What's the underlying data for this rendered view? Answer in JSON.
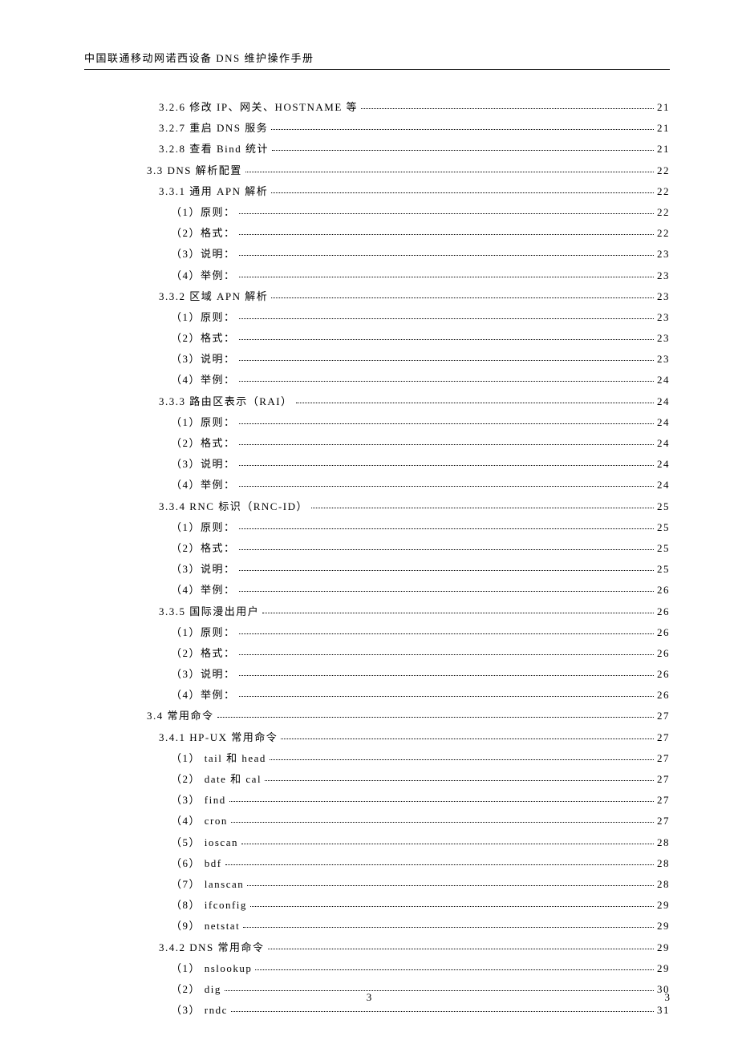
{
  "header": "中国联通移动网诺西设备 DNS 维护操作手册",
  "toc": [
    {
      "level": "level-3",
      "label": "3.2.6 修改 IP、网关、HOSTNAME 等",
      "page": "21"
    },
    {
      "level": "level-3",
      "label": "3.2.7 重启 DNS 服务",
      "page": "21"
    },
    {
      "level": "level-3",
      "label": "3.2.8 查看 Bind 统计",
      "page": "21"
    },
    {
      "level": "level-2",
      "label": "3.3 DNS 解析配置",
      "page": "22"
    },
    {
      "level": "level-3",
      "label": "3.3.1 通用 APN 解析",
      "page": "22"
    },
    {
      "level": "level-4",
      "label": "（1）原则：",
      "page": "22"
    },
    {
      "level": "level-4",
      "label": "（2）格式：",
      "page": "22"
    },
    {
      "level": "level-4",
      "label": "（3）说明：",
      "page": "23"
    },
    {
      "level": "level-4",
      "label": "（4）举例：",
      "page": "23"
    },
    {
      "level": "level-3",
      "label": "3.3.2 区域 APN 解析",
      "page": "23"
    },
    {
      "level": "level-4",
      "label": "（1）原则：",
      "page": "23"
    },
    {
      "level": "level-4",
      "label": "（2）格式：",
      "page": "23"
    },
    {
      "level": "level-4",
      "label": "（3）说明：",
      "page": "23"
    },
    {
      "level": "level-4",
      "label": "（4）举例：",
      "page": "24"
    },
    {
      "level": "level-3",
      "label": "3.3.3 路由区表示（RAI）",
      "page": "24"
    },
    {
      "level": "level-4",
      "label": "（1）原则：",
      "page": "24"
    },
    {
      "level": "level-4",
      "label": "（2）格式：",
      "page": "24"
    },
    {
      "level": "level-4",
      "label": "（3）说明：",
      "page": "24"
    },
    {
      "level": "level-4",
      "label": "（4）举例：",
      "page": "24"
    },
    {
      "level": "level-3",
      "label": "3.3.4 RNC 标识（RNC-ID）",
      "page": "25"
    },
    {
      "level": "level-4",
      "label": "（1）原则：",
      "page": "25"
    },
    {
      "level": "level-4",
      "label": "（2）格式：",
      "page": "25"
    },
    {
      "level": "level-4",
      "label": "（3）说明：",
      "page": "25"
    },
    {
      "level": "level-4",
      "label": "（4）举例：",
      "page": "26"
    },
    {
      "level": "level-3",
      "label": "3.3.5 国际漫出用户",
      "page": "26"
    },
    {
      "level": "level-4",
      "label": "（1）原则：",
      "page": "26"
    },
    {
      "level": "level-4",
      "label": "（2）格式：",
      "page": "26"
    },
    {
      "level": "level-4",
      "label": "（3）说明：",
      "page": "26"
    },
    {
      "level": "level-4",
      "label": "（4）举例：",
      "page": "26"
    },
    {
      "level": "level-2",
      "label": "3.4 常用命令",
      "page": "27"
    },
    {
      "level": "level-3",
      "label": "3.4.1 HP-UX 常用命令",
      "page": "27"
    },
    {
      "level": "level-4b",
      "label": "（1）  tail 和 head",
      "page": "27"
    },
    {
      "level": "level-4b",
      "label": "（2）  date 和 cal",
      "page": "27"
    },
    {
      "level": "level-4b",
      "label": "（3）  find",
      "page": "27"
    },
    {
      "level": "level-4b",
      "label": "（4）  cron",
      "page": "27"
    },
    {
      "level": "level-4b",
      "label": "（5）  ioscan",
      "page": "28"
    },
    {
      "level": "level-4b",
      "label": "（6）  bdf",
      "page": "28"
    },
    {
      "level": "level-4b",
      "label": "（7）  lanscan",
      "page": "28"
    },
    {
      "level": "level-4b",
      "label": "（8）  ifconfig",
      "page": "29"
    },
    {
      "level": "level-4b",
      "label": "（9）  netstat",
      "page": "29"
    },
    {
      "level": "level-3",
      "label": "3.4.2 DNS 常用命令",
      "page": "29"
    },
    {
      "level": "level-4b",
      "label": "（1）  nslookup",
      "page": "29"
    },
    {
      "level": "level-4b",
      "label": "（2）  dig",
      "page": "30"
    },
    {
      "level": "level-4b",
      "label": "（3）  rndc",
      "page": "31"
    }
  ],
  "page_number_center": "3",
  "page_number_right": "3"
}
